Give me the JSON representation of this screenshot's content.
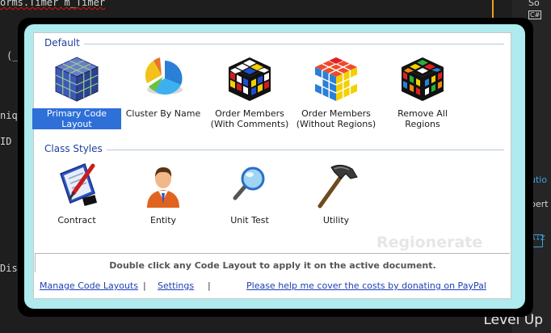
{
  "background_code": {
    "line1": "orms.Timer m_Timer",
    "line2": "(_",
    "line3": "niqu",
    "line4": "ID",
    "line5": "Disp"
  },
  "right_panel": {
    "item1": "So",
    "item2": "C#",
    "item3": "utio",
    "item4": "pert",
    "az": "A↓Z"
  },
  "watermark_corner": "Level Up",
  "groups": {
    "default": {
      "title": "Default",
      "items": [
        {
          "label": "Primary Code Layout",
          "icon": "blue-cube-icon",
          "selected": true
        },
        {
          "label": "Cluster By Name",
          "icon": "pie-chart-icon"
        },
        {
          "label": "Order Members (With Comments)",
          "icon": "rubiks-cube-icon"
        },
        {
          "label": "Order Members (Without Regions)",
          "icon": "rubiks-cube-icon"
        },
        {
          "label": "Remove All Regions",
          "icon": "rubiks-cube-scrambled-icon"
        }
      ]
    },
    "class_styles": {
      "title": "Class Styles",
      "items": [
        {
          "label": "Contract",
          "icon": "contract-pen-icon"
        },
        {
          "label": "Entity",
          "icon": "person-icon"
        },
        {
          "label": "Unit Test",
          "icon": "magnifier-icon"
        },
        {
          "label": "Utility",
          "icon": "hammer-icon"
        }
      ]
    }
  },
  "brand_watermark": "Regionerate",
  "status_text": "Double click any Code Layout to apply it on the active document.",
  "footer": {
    "manage_link": "Manage Code Layouts",
    "settings_link": "Settings",
    "donate_link": "Please help me cover the costs by donating on PayPal",
    "separator": "|"
  },
  "colors": {
    "frame": "#aeeaee",
    "group_title": "#1e3f9c",
    "selection": "#2e6fd8",
    "link": "#1a3fb5"
  }
}
